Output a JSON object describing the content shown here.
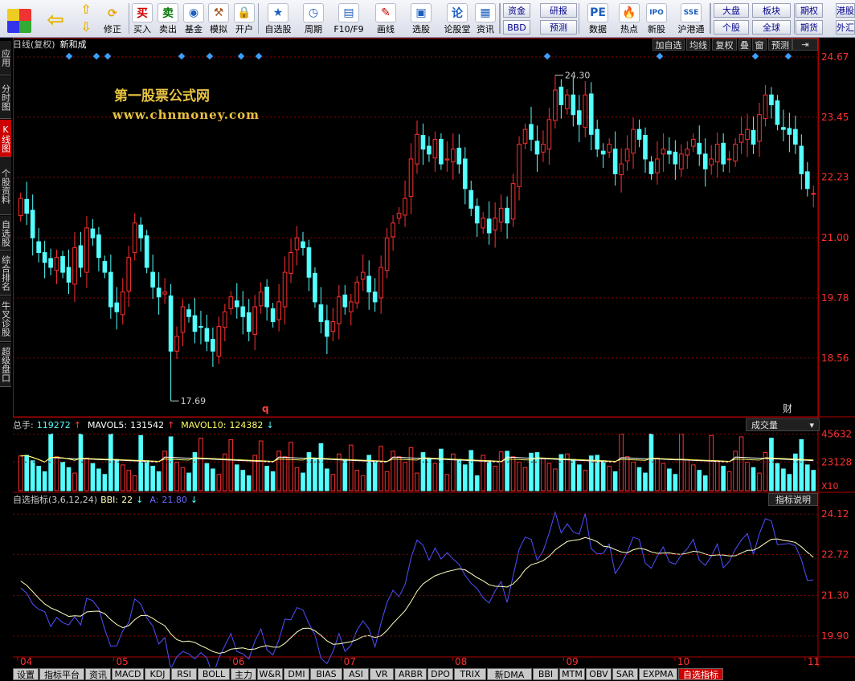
{
  "toolbar": {
    "buttons": [
      {
        "label": "买入",
        "icon": "buy-icon",
        "glyph": "买",
        "color": "#d00000"
      },
      {
        "label": "卖出",
        "icon": "sell-icon",
        "glyph": "卖",
        "color": "#0a7a0a"
      },
      {
        "label": "基金",
        "icon": "fund-icon",
        "glyph": "◉",
        "color": "#1d5fbf"
      },
      {
        "label": "模拟",
        "icon": "gavel-icon",
        "glyph": "⚒",
        "color": "#a0521d"
      },
      {
        "label": "开户",
        "icon": "lock-icon",
        "glyph": "🔒",
        "color": "#c8a000"
      },
      {
        "label": "自选股",
        "icon": "favorites-icon",
        "glyph": "★",
        "color": "#1d5fbf"
      },
      {
        "label": "周期",
        "icon": "clock-icon",
        "glyph": "◷",
        "color": "#1d5fbf"
      },
      {
        "label": "F10/F9",
        "icon": "f10-icon",
        "glyph": "▤",
        "color": "#1d5fbf"
      },
      {
        "label": "画线",
        "icon": "pen-icon",
        "glyph": "✎",
        "color": "#c00000"
      },
      {
        "label": "选股",
        "icon": "screener-icon",
        "glyph": "▣",
        "color": "#1d5fbf"
      },
      {
        "label": "论股堂",
        "icon": "forum-icon",
        "glyph": "论",
        "color": "#1d5fbf"
      },
      {
        "label": "资讯",
        "icon": "news-icon",
        "glyph": "▦",
        "color": "#1d5fbf"
      },
      {
        "label": "数据",
        "icon": "pe-data-icon",
        "glyph": "PE",
        "color": "#1d5fbf"
      },
      {
        "label": "热点",
        "icon": "hot-icon",
        "glyph": "🔥",
        "color": "#e04000"
      },
      {
        "label": "新股",
        "icon": "ipo-icon",
        "glyph": "IPO",
        "color": "#1d5fbf"
      },
      {
        "label": "沪港通",
        "icon": "hk-connect-icon",
        "glyph": "SSE",
        "color": "#1d5fbf"
      }
    ],
    "nav": {
      "back_icon": "back-arrow-icon",
      "up_icon": "up-arrow-icon",
      "down_icon": "down-arrow-icon",
      "edit_label": "修正",
      "menu_icon": "menu-grid-icon"
    },
    "small_buttons": [
      "资金",
      "BBD",
      "研报",
      "预测",
      "大盘",
      "个股",
      "板块",
      "全球",
      "期权",
      "期货",
      "港股",
      "外汇"
    ]
  },
  "sidebar": {
    "items": [
      {
        "label": "应用",
        "active": false
      },
      {
        "label": "分时图",
        "active": false
      },
      {
        "label": "K线图",
        "active": true
      },
      {
        "label": "个股资料",
        "active": false
      },
      {
        "label": "自选股",
        "active": false
      },
      {
        "label": "综合排名",
        "active": false
      },
      {
        "label": "牛叉诊股",
        "active": false
      },
      {
        "label": "超级盘口",
        "active": false
      }
    ]
  },
  "kline": {
    "title": "日线(复权)",
    "stock_name": "新和成",
    "right_buttons": [
      "加自选",
      "均线",
      "复权",
      "叠",
      "窗",
      "预测"
    ],
    "price_ticks": [
      "24.67",
      "23.45",
      "22.23",
      "21.00",
      "19.78",
      "18.56"
    ],
    "high_label": "24.30",
    "low_label": "17.69",
    "marker_q": "q",
    "marker_cai": "财"
  },
  "watermark": {
    "line1": "第一股票公式网",
    "line2": "www.chnmoney.com"
  },
  "volume": {
    "label_total": "总手:",
    "total": "119272",
    "ma5_label": "MAVOL5:",
    "ma5": "131542",
    "ma10_label": "MAVOL10:",
    "ma10": "124382",
    "dropdown": "成交量",
    "ticks": [
      "45632",
      "23128"
    ],
    "unit": "X10"
  },
  "indicator": {
    "title": "自选指标(3,6,12,24)",
    "bbi_label": "BBI:",
    "bbi": "22",
    "a_label": "A:",
    "a": "21.80",
    "help_button": "指标说明",
    "ticks": [
      "24.12",
      "22.72",
      "21.30",
      "19.90"
    ]
  },
  "x_axis": [
    "04",
    "05",
    "06",
    "07",
    "08",
    "09",
    "10",
    "11"
  ],
  "bottom_tabs": [
    "设置",
    "指标平台",
    "资讯",
    "MACD",
    "KDJ",
    "RSI",
    "BOLL",
    "主力",
    "W&R",
    "DMI",
    "BIAS",
    "ASI",
    "VR",
    "ARBR",
    "DPO",
    "TRIX",
    "新DMA",
    "BBI",
    "MTM",
    "OBV",
    "SAR",
    "EXPMA",
    "自选指标"
  ],
  "colors": {
    "up": "#ff3030",
    "down": "#54ffff",
    "grid": "#8b0000",
    "axis": "#b00000",
    "bbi": "#ffffc0",
    "a_line": "#5050ff",
    "ma5": "#ffffff",
    "ma10": "#ffff66"
  },
  "chart_data": {
    "type": "candlestick",
    "price_axis_ticks": [
      24.67,
      23.45,
      22.23,
      21.0,
      19.78,
      18.56
    ],
    "ylim": [
      17.4,
      24.8
    ],
    "x_month_labels": [
      "04",
      "05",
      "06",
      "07",
      "08",
      "09",
      "10",
      "11"
    ],
    "annotated_high": 24.3,
    "annotated_low": 17.69,
    "closes": [
      21.8,
      21.5,
      21.0,
      20.7,
      20.5,
      20.4,
      20.6,
      20.3,
      20.1,
      20.8,
      20.4,
      21.2,
      21.0,
      20.6,
      20.3,
      19.6,
      19.5,
      19.9,
      20.6,
      21.3,
      21.0,
      20.4,
      20.0,
      19.8,
      19.9,
      18.7,
      19.0,
      19.6,
      19.4,
      19.1,
      19.2,
      18.9,
      18.7,
      19.2,
      19.5,
      19.8,
      19.6,
      19.4,
      19.1,
      19.6,
      19.9,
      19.6,
      19.3,
      19.7,
      20.3,
      20.7,
      21.0,
      20.8,
      20.2,
      19.7,
      19.3,
      19.0,
      19.3,
      19.8,
      19.6,
      19.7,
      20.1,
      20.3,
      19.9,
      19.7,
      20.4,
      21.0,
      21.3,
      21.5,
      21.8,
      22.6,
      23.1,
      22.8,
      22.7,
      23.0,
      22.5,
      22.6,
      22.8,
      22.5,
      22.0,
      21.6,
      21.3,
      21.4,
      21.1,
      21.4,
      21.6,
      21.3,
      22.1,
      22.9,
      23.2,
      23.0,
      22.7,
      22.9,
      23.4,
      24.0,
      23.7,
      23.9,
      23.5,
      23.3,
      23.9,
      23.1,
      22.8,
      22.7,
      22.9,
      22.3,
      22.5,
      22.8,
      23.2,
      23.0,
      22.6,
      22.3,
      22.6,
      22.8,
      22.7,
      22.5,
      22.7,
      22.8,
      23.0,
      22.7,
      22.4,
      22.6,
      22.9,
      22.5,
      22.6,
      22.9,
      23.1,
      23.2,
      22.9,
      23.5,
      23.9,
      23.7,
      23.3,
      23.2,
      23.1,
      22.9,
      22.3,
      22.0,
      21.9
    ],
    "volume_ticks": [
      45632,
      23128
    ],
    "volume_unit": "X10",
    "volume_last": 119272,
    "mavol5": 131542,
    "mavol10": 124382,
    "indicator_ticks": [
      24.12,
      22.72,
      21.3,
      19.9
    ],
    "bbi_last": 22,
    "a_last": 21.8
  }
}
